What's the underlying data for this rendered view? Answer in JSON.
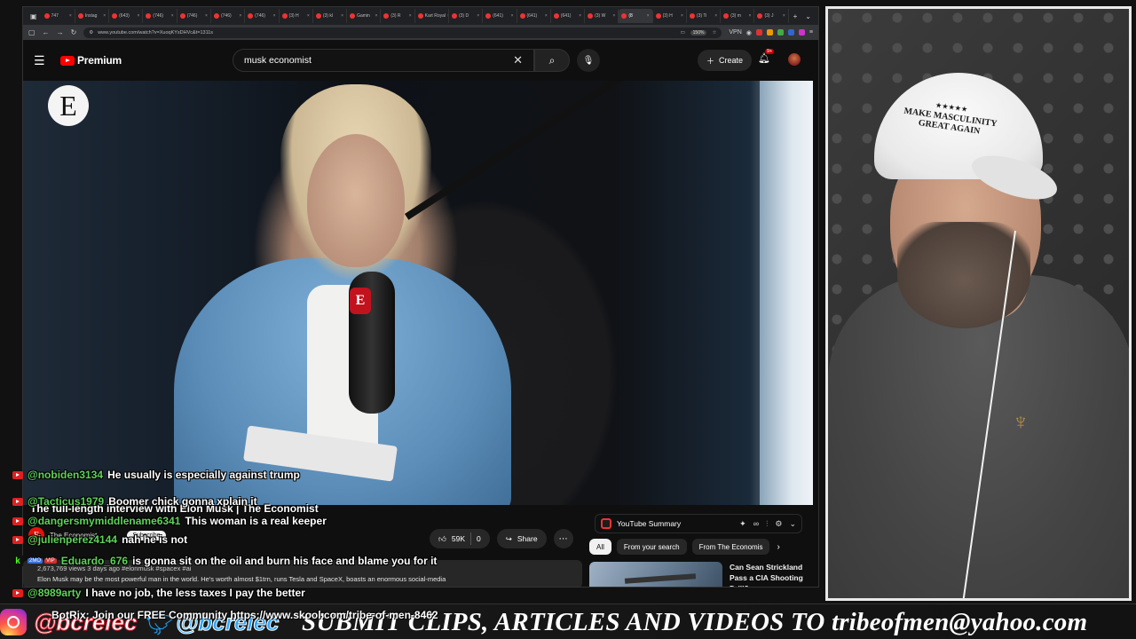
{
  "browser": {
    "tabs": [
      "747",
      "Instag",
      "(643)",
      "(746)",
      "(746)",
      "(746)",
      "(746)",
      "(3) H",
      "(3) kl",
      "Gamin",
      "(3) R",
      "Kart Royal",
      "(3) D",
      "(641)",
      "(641)",
      "(641)",
      "(3) W",
      "(8",
      "(3) H",
      "(3) Ti",
      "(3) m",
      "(3) J"
    ],
    "active_tab_index": 17,
    "new_tab": "+",
    "url": "www.youtube.com/watch?v=XuoqKYsDHVc&t=1311s",
    "zoom": "150%",
    "vpn": "VPN"
  },
  "youtube": {
    "logo_text": "Premium",
    "search_value": "musk economist",
    "create_label": "Create",
    "notification_count": "9+",
    "video_channel_logo": "E",
    "mic_badge": "E",
    "like_count": "59K",
    "dislike_count": "0",
    "share_label": "Share",
    "channel_name": "The Economist",
    "subscribe_label": "Subscribe",
    "video_title_overlay": "The full-length interview with Elon Musk | The Economist",
    "views_line": "2,673,769 views  3 days ago  #elonmusk #spacex #ai",
    "description": "Elon Musk may be the most powerful man in the world. He's worth almost $1trn, runs Tesla and SpaceX, boasts an enormous social-media",
    "side_panel": {
      "summary_label": "YouTube Summary",
      "chips": [
        "All",
        "From your search",
        "From The Economis"
      ],
      "rec_title": "Can Sean Strickland Pass a CIA Shooting Drill?"
    }
  },
  "chat": [
    {
      "platform": "youtube",
      "user": "@nobiden3134",
      "msg": "He usually is especially against trump"
    },
    {
      "platform": "youtube",
      "user": "@Tacticus1979",
      "msg": "Boomer chick gonna xplain it"
    },
    {
      "platform": "youtube",
      "user": "@dangersmymiddlename6341",
      "msg": "This woman is a real keeper"
    },
    {
      "platform": "youtube",
      "user": "@julienperez4144",
      "msg": "nah he is not"
    },
    {
      "platform": "kick",
      "user": "Eduardo_676",
      "msg": "is gonna sit on the oil and burn his face and blame you for it",
      "badges": [
        "2MO",
        "VIP"
      ]
    },
    {
      "platform": "youtube",
      "user": "@8989arty",
      "msg": "I have no job, the less taxes I pay the better"
    }
  ],
  "webcam": {
    "cap_text_line1": "MAKE MASCULINITY",
    "cap_text_line2": "GREAT AGAIN",
    "cap_stars": "★★★★★"
  },
  "ticker": {
    "handle_ig": "@bcrelec",
    "handle_tw": "@bcrelec",
    "botrix": "BotRix: Join our FREE Community https://www.skool.com/tribe-of-men-8462",
    "banner": "SUBMIT CLIPS, ARTICLES AND VIDEOS TO tribeofmen@yahoo.com"
  }
}
